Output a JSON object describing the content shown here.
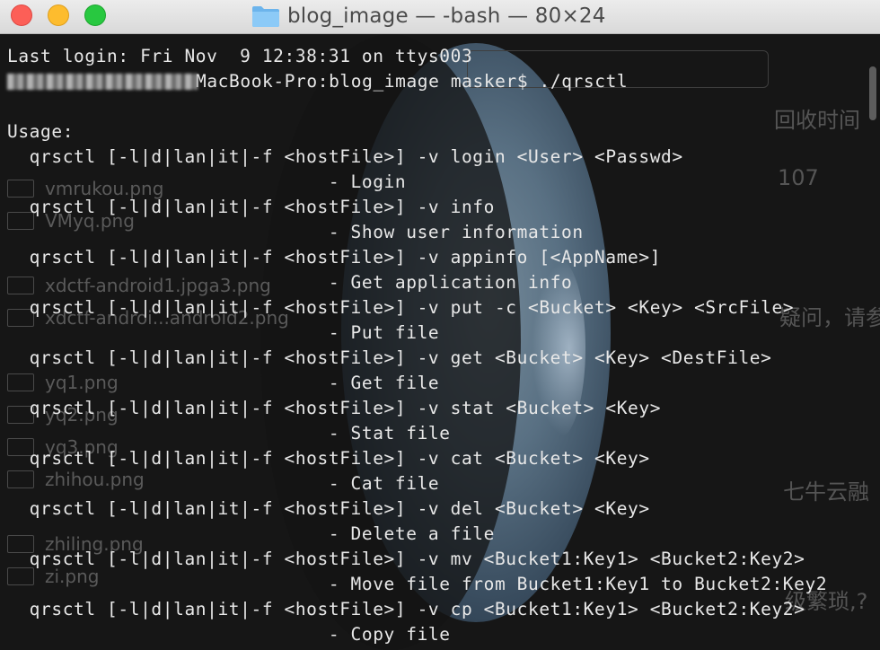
{
  "window": {
    "title": "blog_image — -bash — 80×24",
    "folder_icon": "folder-icon"
  },
  "background": {
    "files": [
      "vmrukou.png",
      "VMyq.png",
      "xdctf-android1.jpga3.png",
      "xdctf-androi...android2.png",
      "yq1.png",
      "yq2.png",
      "yq3.png",
      "zhihou.png",
      "zhiling.png",
      "zi.png"
    ],
    "right_texts": [
      "回收时间",
      "107",
      "疑问，请参",
      "七牛云融",
      "级繁琐,?"
    ]
  },
  "terminal": {
    "last_login": "Last login: Fri Nov  9 12:38:31 on ttys003",
    "prompt_suffix": "MacBook-Pro:blog_image masker$ ./qrsctl",
    "usage": "Usage:",
    "commands": [
      {
        "cmd": "  qrsctl [-l|d|lan|it|-f <hostFile>] -v login <User> <Passwd>",
        "desc": "                             - Login"
      },
      {
        "cmd": "  qrsctl [-l|d|lan|it|-f <hostFile>] -v info",
        "desc": "                             - Show user information"
      },
      {
        "cmd": "  qrsctl [-l|d|lan|it|-f <hostFile>] -v appinfo [<AppName>]",
        "desc": "                             - Get application info"
      },
      {
        "cmd": "  qrsctl [-l|d|lan|it|-f <hostFile>] -v put -c <Bucket> <Key> <SrcFile>",
        "desc": "                             - Put file"
      },
      {
        "cmd": "  qrsctl [-l|d|lan|it|-f <hostFile>] -v get <Bucket> <Key> <DestFile>",
        "desc": "                             - Get file"
      },
      {
        "cmd": "  qrsctl [-l|d|lan|it|-f <hostFile>] -v stat <Bucket> <Key>",
        "desc": "                             - Stat file"
      },
      {
        "cmd": "  qrsctl [-l|d|lan|it|-f <hostFile>] -v cat <Bucket> <Key>",
        "desc": "                             - Cat file"
      },
      {
        "cmd": "  qrsctl [-l|d|lan|it|-f <hostFile>] -v del <Bucket> <Key>",
        "desc": "                             - Delete a file"
      },
      {
        "cmd": "  qrsctl [-l|d|lan|it|-f <hostFile>] -v mv <Bucket1:Key1> <Bucket2:Key2>",
        "desc": "                             - Move file from Bucket1:Key1 to Bucket2:Key2"
      },
      {
        "cmd": "  qrsctl [-l|d|lan|it|-f <hostFile>] -v cp <Bucket1:Key1> <Bucket2:Key2>",
        "desc": "                             - Copy file"
      }
    ]
  }
}
